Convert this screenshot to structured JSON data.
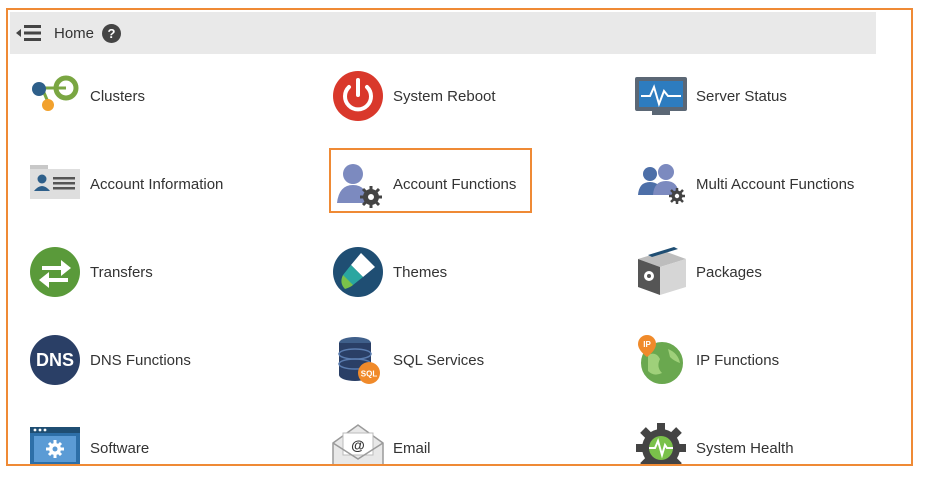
{
  "topbar": {
    "title": "Home",
    "help_symbol": "?"
  },
  "tiles": [
    {
      "label": "Clusters",
      "icon": "clusters-icon"
    },
    {
      "label": "System Reboot",
      "icon": "power-icon"
    },
    {
      "label": "Server Status",
      "icon": "monitor-icon"
    },
    {
      "label": "Account Information",
      "icon": "id-card-icon"
    },
    {
      "label": "Account Functions",
      "icon": "user-gear-icon"
    },
    {
      "label": "Multi Account Functions",
      "icon": "users-gear-icon"
    },
    {
      "label": "Transfers",
      "icon": "transfer-arrows-icon"
    },
    {
      "label": "Themes",
      "icon": "paint-brush-icon"
    },
    {
      "label": "Packages",
      "icon": "package-box-icon"
    },
    {
      "label": "DNS Functions",
      "icon": "dns-icon"
    },
    {
      "label": "SQL Services",
      "icon": "database-icon"
    },
    {
      "label": "IP Functions",
      "icon": "globe-ip-icon"
    },
    {
      "label": "Software",
      "icon": "software-window-icon"
    },
    {
      "label": "Email",
      "icon": "envelope-icon"
    },
    {
      "label": "System Health",
      "icon": "gear-pulse-icon"
    }
  ],
  "icon_text": {
    "dns": "DNS",
    "sql": "SQL",
    "ip": "IP",
    "email_at": "@"
  },
  "colors": {
    "accent_border": "#ef8a35",
    "topbar_bg": "#e9e9e9"
  }
}
